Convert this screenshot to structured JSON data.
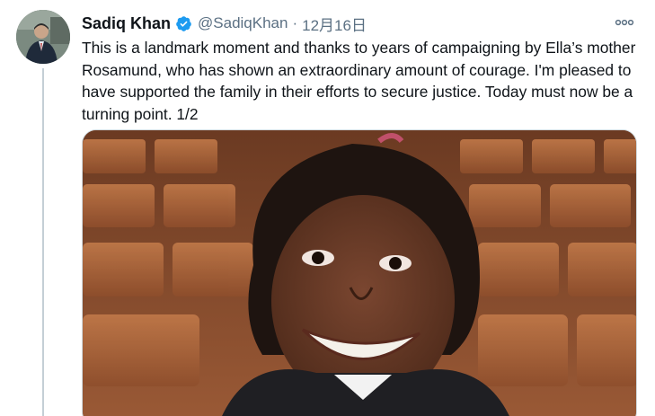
{
  "tweet": {
    "display_name": "Sadiq Khan",
    "handle": "@SadiqKhan",
    "separator": "·",
    "date": "12月16日",
    "text": "This is a landmark moment and thanks to years of campaigning by Ella’s mother Rosamund, who has shown an extraordinary amount of courage. I'm pleased to have supported the family in their efforts to secure justice. Today must now be a turning point. 1/2",
    "verified": true,
    "icons": {
      "verified": "verified-badge-icon",
      "more": "more-options-icon"
    },
    "colors": {
      "verified_badge": "#1d9bf0",
      "secondary_text": "#5b7083",
      "primary_text": "#0f1419",
      "thread_line": "#c4cfd6"
    }
  }
}
